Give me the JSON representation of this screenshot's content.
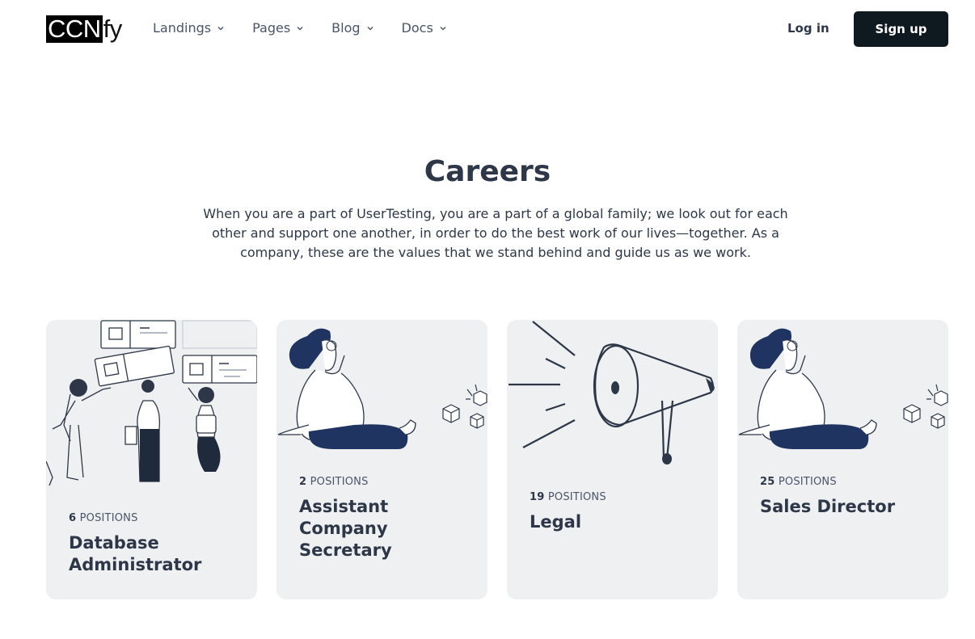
{
  "header": {
    "logo_highlight": "CCN",
    "logo_rest": "fy",
    "nav": [
      {
        "label": "Landings"
      },
      {
        "label": "Pages"
      },
      {
        "label": "Blog"
      },
      {
        "label": "Docs"
      }
    ],
    "login_label": "Log in",
    "signup_label": "Sign up"
  },
  "hero": {
    "title": "Careers",
    "description": "When you are a part of UserTesting, you are a part of a global family; we look out for each other and support one another, in order to do the best work of our lives—together. As a company, these are the values that we stand behind and guide us as we work."
  },
  "cards": [
    {
      "count": "6",
      "positions_label": "POSITIONS",
      "role": "Database Administrator",
      "illustration": "team-collaboration"
    },
    {
      "count": "2",
      "positions_label": "POSITIONS",
      "role": "Assistant Company Secretary",
      "illustration": "thinking-person"
    },
    {
      "count": "19",
      "positions_label": "POSITIONS",
      "role": "Legal",
      "illustration": "megaphone"
    },
    {
      "count": "25",
      "positions_label": "POSITIONS",
      "role": "Sales Director",
      "illustration": "thinking-person"
    }
  ],
  "colors": {
    "navy": "#1f3461",
    "card_bg": "#eef0f2",
    "button_bg": "#0f1a20",
    "text": "#2d3748"
  }
}
